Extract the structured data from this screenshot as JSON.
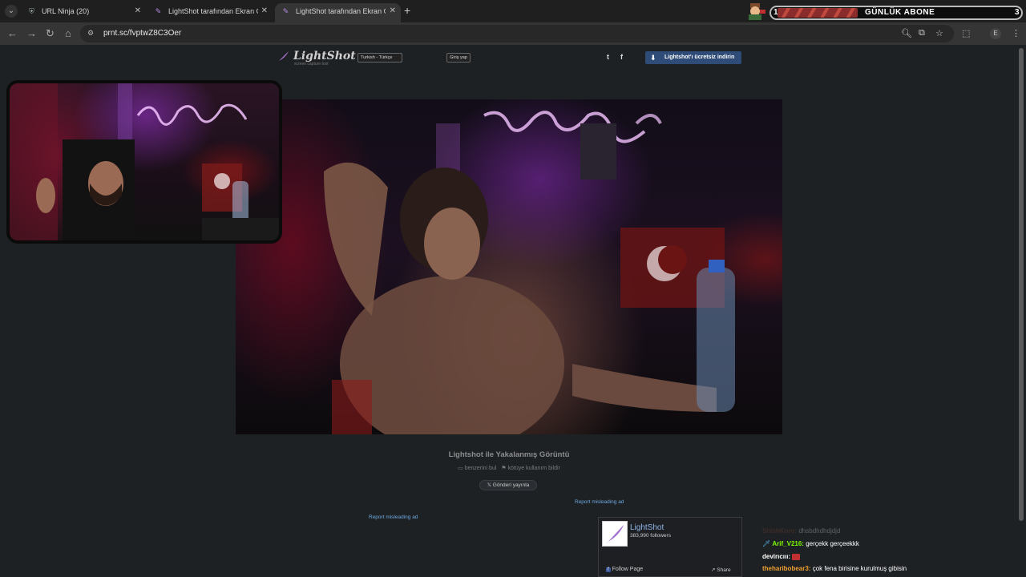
{
  "browser": {
    "tabs": [
      {
        "title": "URL Ninja (20)",
        "icon": "shield-icon",
        "active": false
      },
      {
        "title": "LightShot tarafından Ekran Görü",
        "icon": "feather-icon",
        "active": false
      },
      {
        "title": "LightShot tarafından Ekran Görü",
        "icon": "feather-icon",
        "active": true
      }
    ],
    "new_tab": "+",
    "url": "prnt.sc/fvptwZ8C3Oer",
    "profile_initial": "E"
  },
  "stream_overlay": {
    "goal_left": "1",
    "goal_title": "GÜNLÜK ABONE",
    "goal_right": "3"
  },
  "lightshot": {
    "logo": "LightShot",
    "logo_sub": "screen capture tool",
    "language": "Turkish - Türkçe",
    "login": "Giriş yap",
    "twitter": "t",
    "facebook": "f",
    "download": "Lightshot'ı ücretsiz indirin",
    "caption_title": "Lightshot ile Yakalanmış Görüntü",
    "find_similar": "benzerini bul",
    "report_abuse": "kötüye kullanım bildir",
    "tweet": "Gönderi yayınla",
    "report_ad": "Report misleading ad"
  },
  "facebook_widget": {
    "page_name": "LightShot",
    "followers": "383,990 followers",
    "follow": "Follow Page",
    "share": "Share"
  },
  "chat": [
    {
      "user": "ShishKoro:",
      "message": "dhsbdhdhdjdjd",
      "color": "#6b3a2a",
      "faded": true
    },
    {
      "user": "Arif_V216:",
      "message": "gerçekk gerçeekkk",
      "color": "#7cfc00",
      "badge": "sword"
    },
    {
      "user": "devirıcııı:",
      "message": "",
      "color": "#ffffff"
    },
    {
      "user": "theharibobear3:",
      "message": "çok fena birisine kurulmuş gibisin",
      "color": "#f0a030"
    }
  ]
}
